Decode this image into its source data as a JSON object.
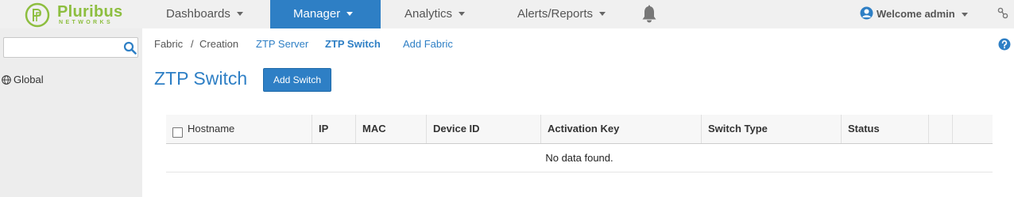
{
  "brand": {
    "name": "Pluribus",
    "sub": "NETWORKS",
    "color": "#8dbe3f"
  },
  "nav": {
    "items": [
      {
        "label": "Dashboards"
      },
      {
        "label": "Manager"
      },
      {
        "label": "Analytics"
      },
      {
        "label": "Alerts/Reports"
      }
    ],
    "user": "Welcome admin"
  },
  "sidebar": {
    "search_placeholder": "",
    "global_label": "Global"
  },
  "breadcrumb": {
    "items": [
      "Fabric",
      "/",
      "Creation",
      "ZTP Server",
      "ZTP Switch",
      "Add Fabric"
    ]
  },
  "page": {
    "title": "ZTP Switch",
    "add_button": "Add Switch"
  },
  "table": {
    "columns": [
      "Hostname",
      "IP",
      "MAC",
      "Device ID",
      "Activation Key",
      "Switch Type",
      "Status"
    ],
    "empty_text": "No data found."
  },
  "colors": {
    "accent": "#2e7fc5",
    "nav_bg": "#f0f0f0",
    "sidebar_bg": "#ededed"
  }
}
